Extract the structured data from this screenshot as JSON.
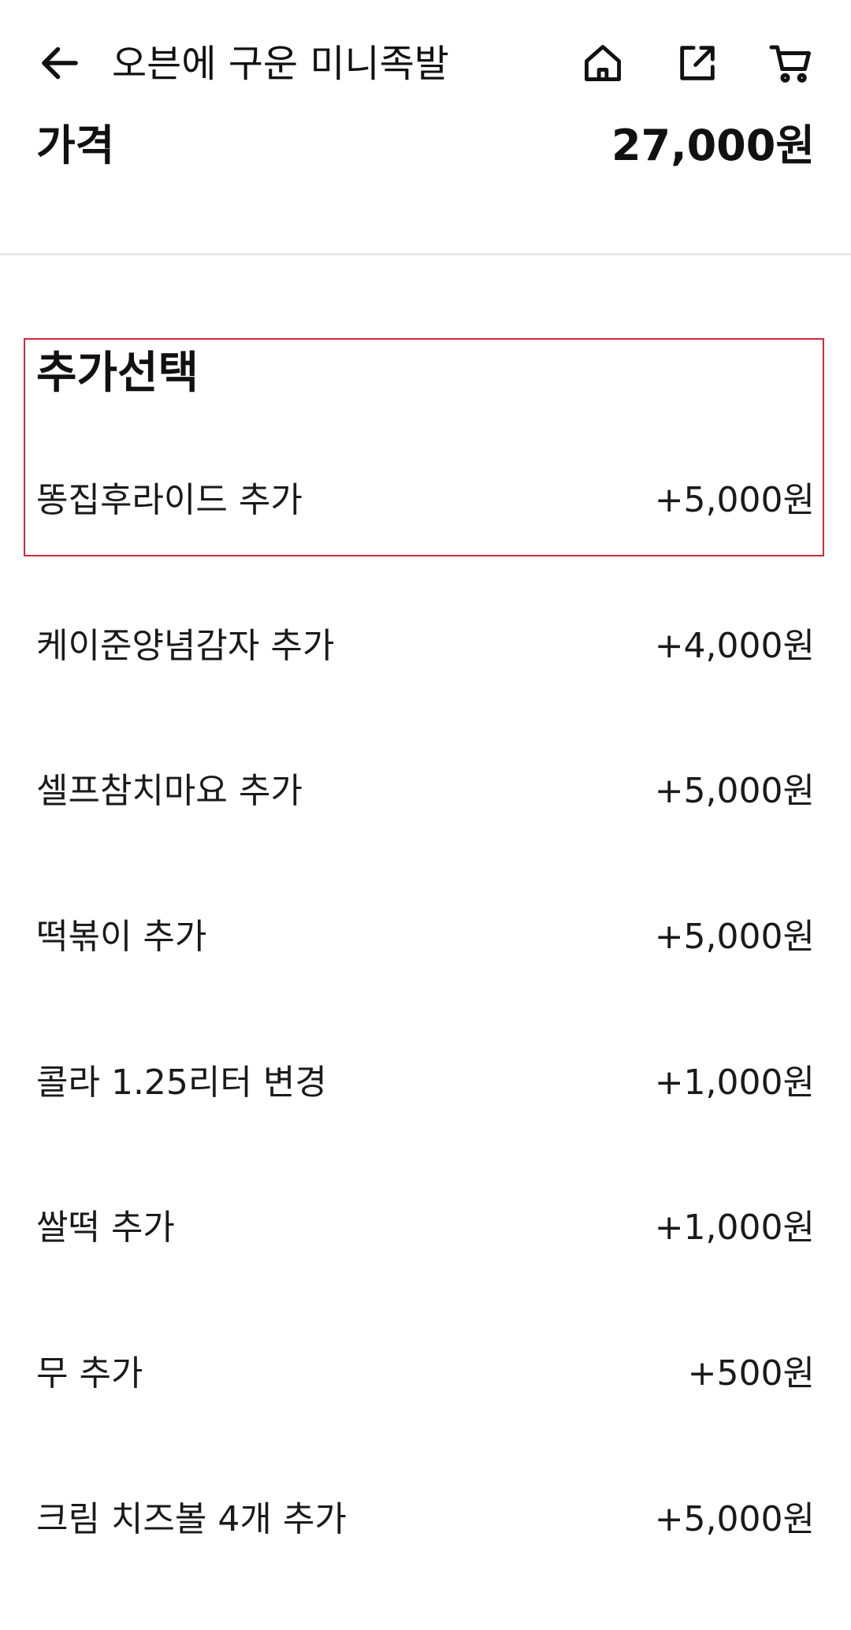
{
  "header": {
    "title": "오븐에 구운 미니족발",
    "icons": {
      "back": "back-arrow-icon",
      "home": "home-icon",
      "share": "share-icon",
      "cart": "cart-icon"
    }
  },
  "price": {
    "label": "가격",
    "value": "27,000원"
  },
  "options_section": {
    "title": "추가선택",
    "highlight_color": "#d22a3b",
    "items": [
      {
        "name": "똥집후라이드 추가",
        "price": "+5,000원"
      },
      {
        "name": "케이준양념감자 추가",
        "price": "+4,000원"
      },
      {
        "name": "셀프참치마요 추가",
        "price": "+5,000원"
      },
      {
        "name": "떡볶이 추가",
        "price": "+5,000원"
      },
      {
        "name": "콜라 1.25리터 변경",
        "price": "+1,000원"
      },
      {
        "name": "쌀떡 추가",
        "price": "+1,000원"
      },
      {
        "name": "무 추가",
        "price": "+500원"
      },
      {
        "name": "크림 치즈볼 4개 추가",
        "price": "+5,000원"
      }
    ]
  }
}
